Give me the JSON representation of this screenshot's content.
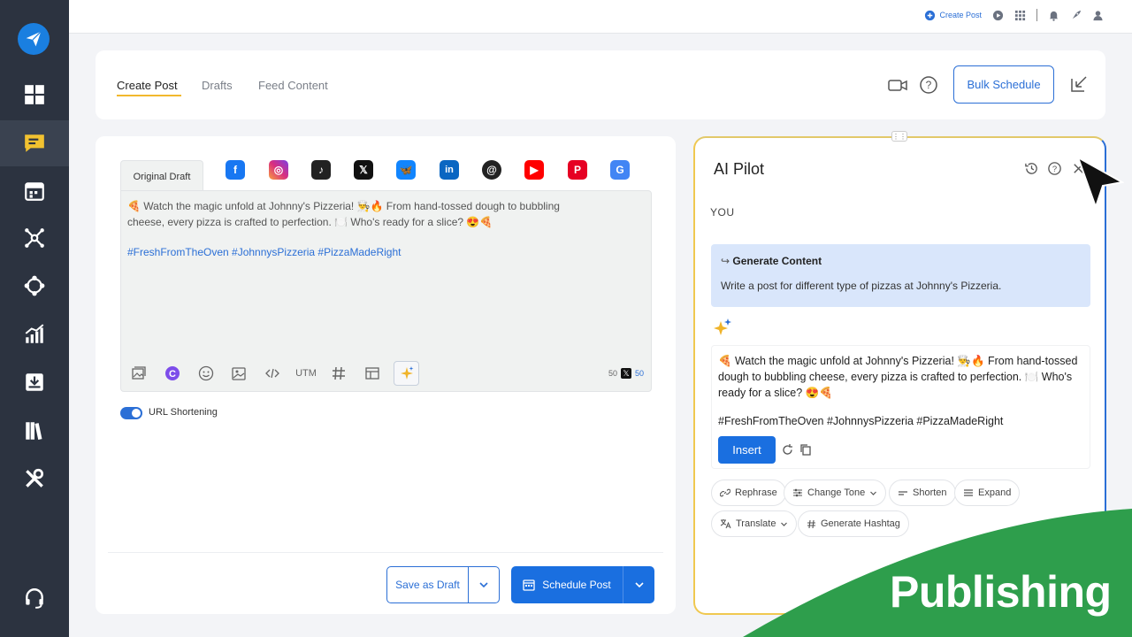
{
  "topbar": {
    "create_post": "Create Post"
  },
  "tabs": {
    "items": [
      "Create Post",
      "Drafts",
      "Feed Content"
    ],
    "bulk_schedule": "Bulk Schedule"
  },
  "editor": {
    "original_draft": "Original Draft",
    "text": "🍕 Watch the magic unfold at Johnny's Pizzeria! 👨‍🍳🔥 From hand-tossed dough to bubbling cheese, every pizza is crafted to perfection. 🍽️ Who's ready for a slice? 😍🍕",
    "hashtags": "#FreshFromTheOven #JohnnysPizzeria #PizzaMadeRight",
    "toolbar_utm": "UTM",
    "char_count": "50",
    "x_count": "50",
    "url_shortening": "URL Shortening",
    "save_as_draft": "Save as Draft",
    "schedule_post": "Schedule Post"
  },
  "ai_pilot": {
    "title": "AI Pilot",
    "you_label": "YOU",
    "prompt_title": "Generate Content",
    "prompt_text": "Write a post for different type of pizzas at Johnny's Pizzeria.",
    "result_text": "🍕 Watch the magic unfold at Johnny's Pizzeria! 👨‍🍳🔥 From hand-tossed dough to bubbling cheese, every pizza is crafted to perfection. 🍽️ Who's ready for a slice? 😍🍕",
    "result_tags": "#FreshFromTheOven #JohnnysPizzeria #PizzaMadeRight",
    "insert": "Insert",
    "actions": [
      "Rephrase",
      "Change Tone",
      "Shorten",
      "Expand",
      "Translate",
      "Generate Hashtag"
    ]
  },
  "overlay": {
    "label": "Publishing"
  },
  "colors": {
    "accent": "#1a6fe0",
    "sidebar": "#2c3340",
    "tab_underline": "#f2b82d",
    "overlay_green": "#2e9e4c"
  }
}
